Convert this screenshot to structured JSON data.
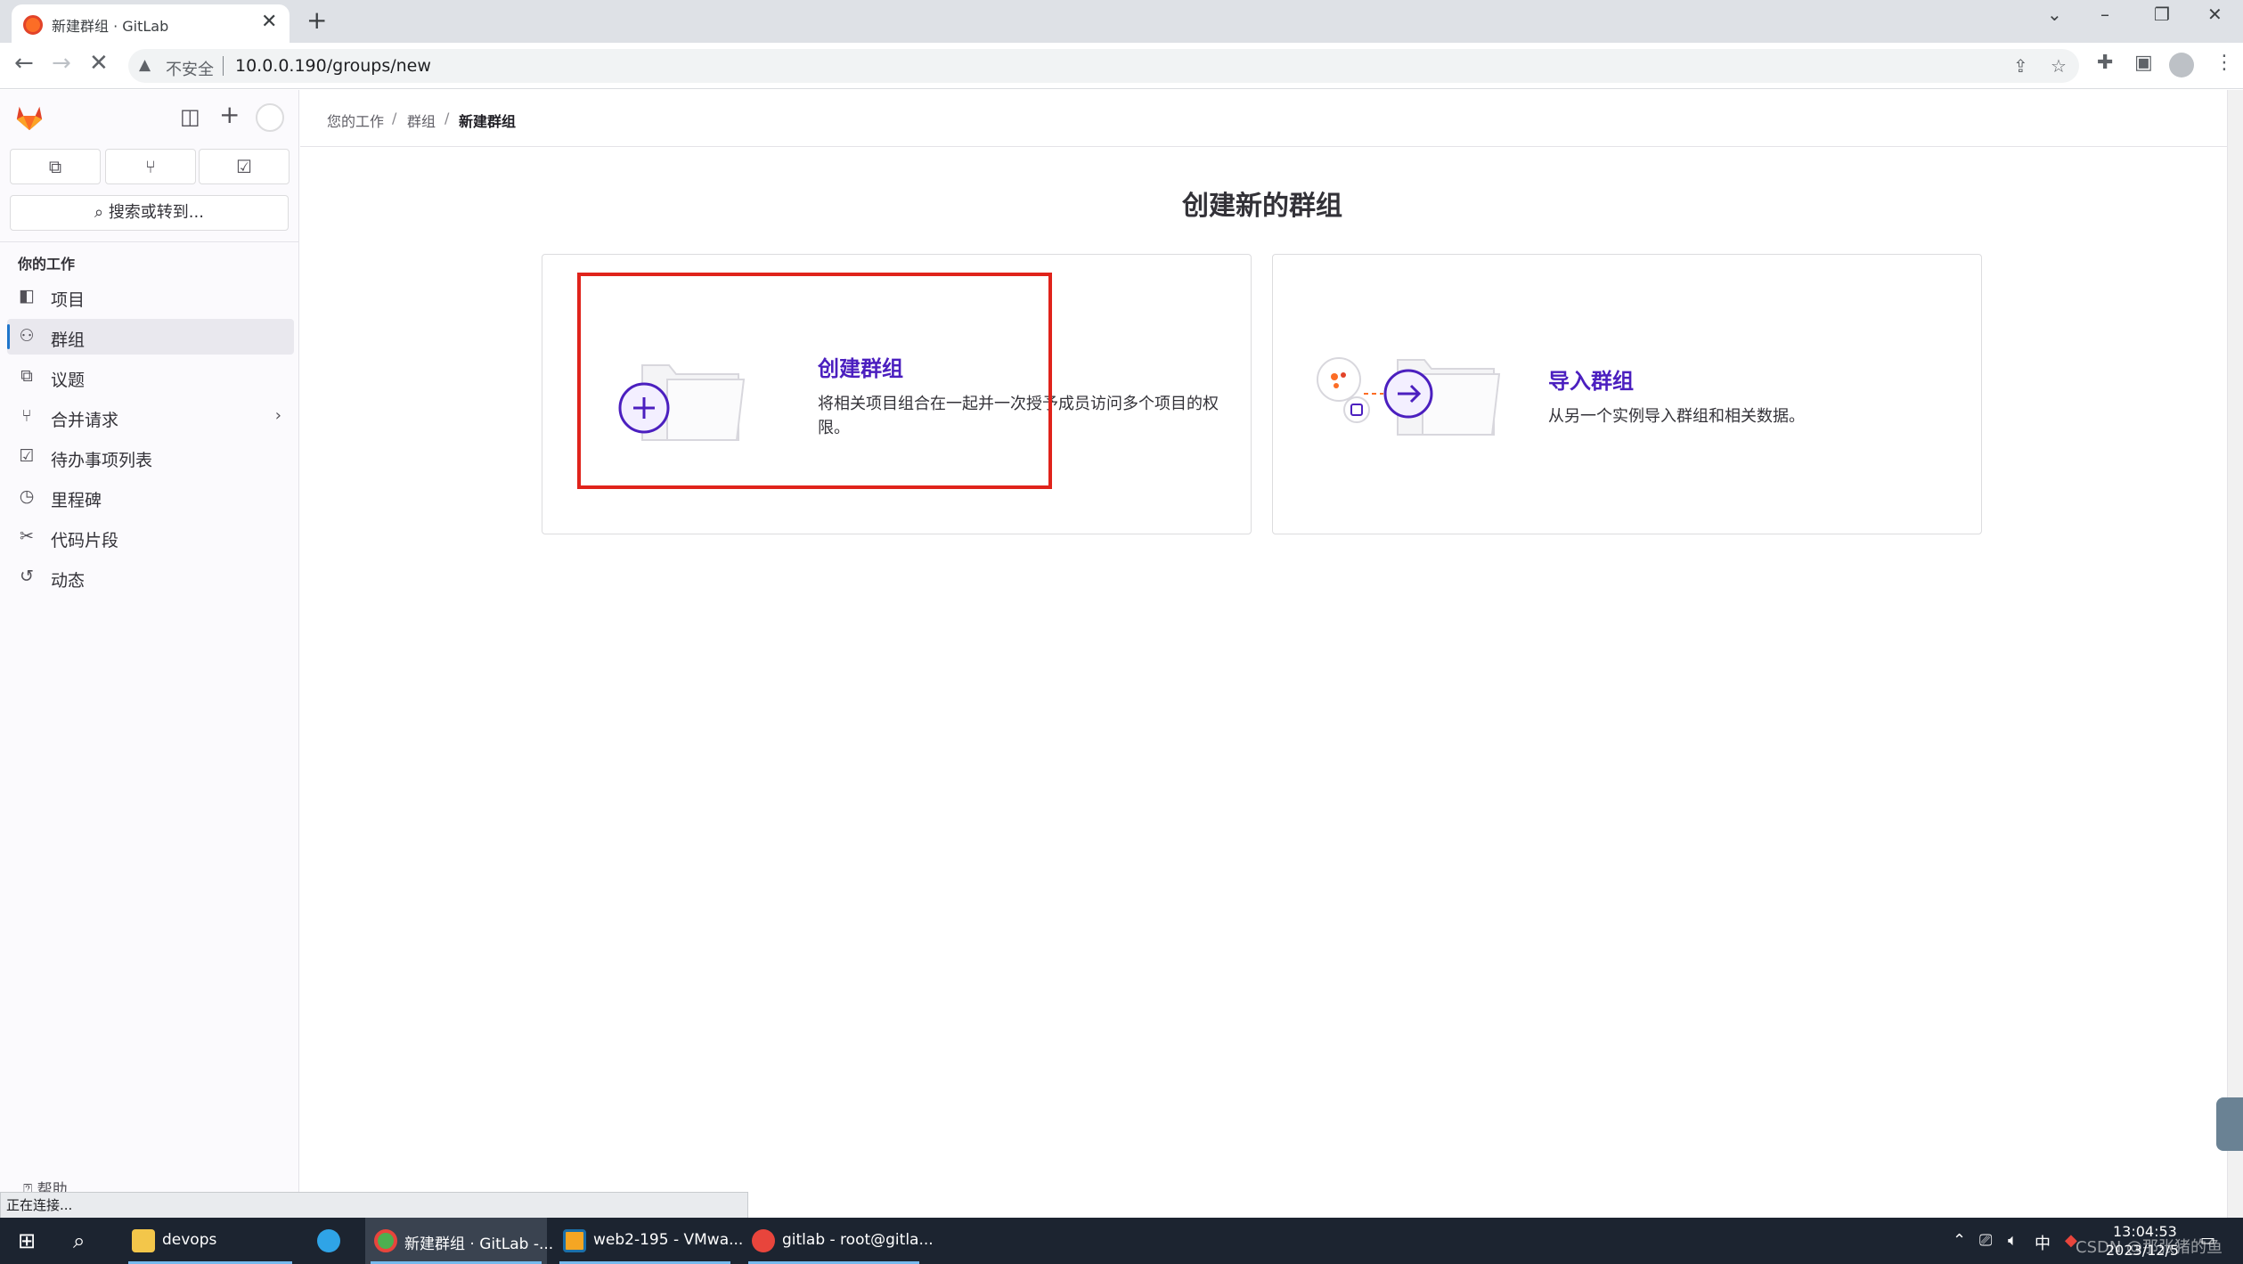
{
  "browser": {
    "tab_title": "新建群组 · GitLab",
    "tab_close": "✕",
    "new_tab": "+",
    "security_label": "不安全",
    "url": "10.0.0.190/groups/new"
  },
  "sidebar": {
    "search_label": "搜索或转到...",
    "section_heading": "你的工作",
    "items": [
      {
        "label": "项目",
        "icon": "project-icon"
      },
      {
        "label": "群组",
        "icon": "group-icon",
        "active": true
      },
      {
        "label": "议题",
        "icon": "issues-icon"
      },
      {
        "label": "合并请求",
        "icon": "merge-request-icon",
        "has_submenu": true
      },
      {
        "label": "待办事项列表",
        "icon": "todo-icon"
      },
      {
        "label": "里程碑",
        "icon": "milestone-icon"
      },
      {
        "label": "代码片段",
        "icon": "snippet-icon"
      },
      {
        "label": "动态",
        "icon": "activity-icon"
      }
    ],
    "help_label": "帮助"
  },
  "breadcrumb": {
    "items": [
      "您的工作",
      "群组",
      "新建群组"
    ],
    "separator": "/"
  },
  "main": {
    "title": "创建新的群组",
    "cards": [
      {
        "title": "创建群组",
        "description": "将相关项目组合在一起并一次授予成员访问多个项目的权限。"
      },
      {
        "title": "导入群组",
        "description": "从另一个实例导入群组和相关数据。"
      }
    ]
  },
  "status_bar": "正在连接...",
  "taskbar": {
    "apps": [
      {
        "label": "devops"
      },
      {
        "label": "新建群组 · GitLab -..."
      },
      {
        "label": "web2-195 - VMwa..."
      },
      {
        "label": "gitlab - root@gitla..."
      }
    ],
    "ime": "中",
    "time": "13:04:53",
    "date": "2023/12/5",
    "watermark": "CSDN @那张猪的鱼"
  },
  "colors": {
    "accent_purple": "#4b1fbf",
    "highlight_red": "#e0231b",
    "active_indicator": "#1f75cb"
  }
}
